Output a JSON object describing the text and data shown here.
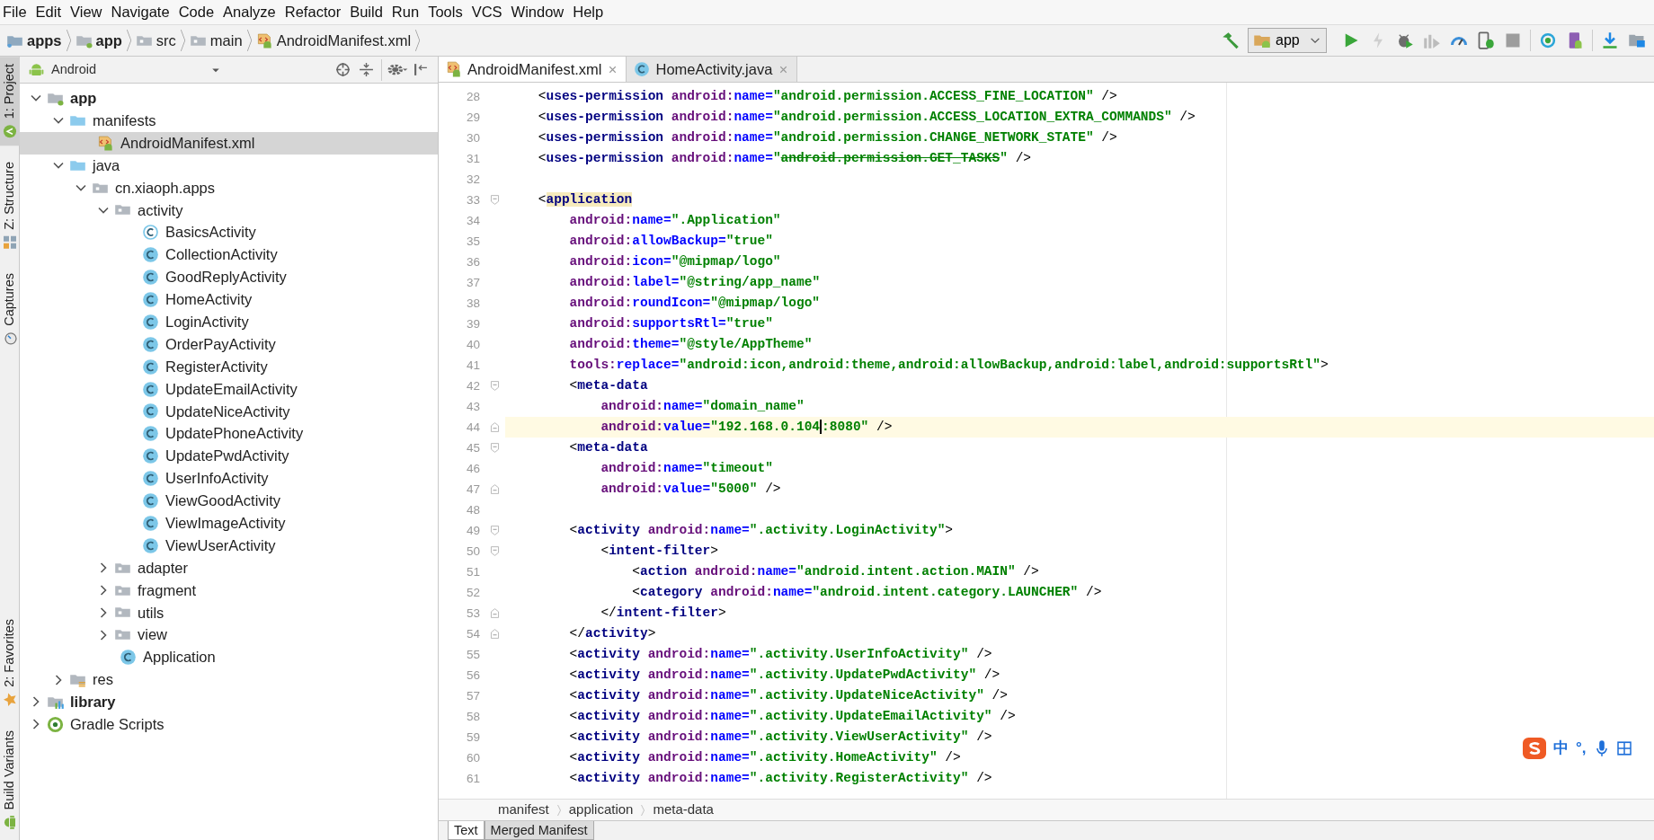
{
  "menu": [
    "File",
    "Edit",
    "View",
    "Navigate",
    "Code",
    "Analyze",
    "Refactor",
    "Build",
    "Run",
    "Tools",
    "VCS",
    "Window",
    "Help"
  ],
  "breadcrumb": [
    {
      "label": "apps",
      "kind": "project"
    },
    {
      "label": "app",
      "kind": "module"
    },
    {
      "label": "src",
      "kind": "folder"
    },
    {
      "label": "main",
      "kind": "folder"
    },
    {
      "label": "AndroidManifest.xml",
      "kind": "manifest"
    }
  ],
  "run_config": {
    "label": "app"
  },
  "toolbar": [
    {
      "kind": "build",
      "disabled": false
    },
    {
      "kind": "run",
      "disabled": false
    },
    {
      "kind": "apply",
      "disabled": true
    },
    {
      "kind": "debug",
      "disabled": false
    },
    {
      "kind": "profile",
      "disabled": true
    },
    {
      "kind": "attach",
      "disabled": false
    },
    {
      "kind": "device_debug",
      "disabled": false
    },
    {
      "kind": "stop",
      "disabled": true
    },
    {
      "kind": "sync",
      "disabled": false
    },
    {
      "kind": "avd",
      "disabled": false
    },
    {
      "kind": "sdk",
      "disabled": false
    },
    {
      "kind": "structure",
      "disabled": false
    }
  ],
  "side_tabs_top": [
    {
      "label": "1: Project",
      "kind": "project",
      "selected": true
    },
    {
      "label": "Z: Structure",
      "kind": "structure",
      "selected": false
    },
    {
      "label": "Captures",
      "kind": "captures",
      "selected": false
    }
  ],
  "side_tabs_bottom": [
    {
      "label": "2: Favorites",
      "kind": "favorites",
      "selected": false
    },
    {
      "label": "Build Variants",
      "kind": "variants",
      "selected": false
    }
  ],
  "project_panel": {
    "view": "Android",
    "tree": [
      {
        "label": "app",
        "kind": "module",
        "expanded": true,
        "selected": false,
        "children": [
          {
            "label": "manifests",
            "kind": "folder",
            "expanded": true,
            "selected": false,
            "children": [
              {
                "label": "AndroidManifest.xml",
                "kind": "manifest",
                "selected": true
              }
            ]
          },
          {
            "label": "java",
            "kind": "folder",
            "expanded": true,
            "selected": false,
            "children": [
              {
                "label": "cn.xiaoph.apps",
                "kind": "package",
                "expanded": true,
                "selected": false,
                "children": [
                  {
                    "label": "activity",
                    "kind": "package",
                    "expanded": true,
                    "selected": false,
                    "children": [
                      {
                        "label": "BasicsActivity",
                        "kind": "abstract_class",
                        "selected": false
                      },
                      {
                        "label": "CollectionActivity",
                        "kind": "class",
                        "selected": false
                      },
                      {
                        "label": "GoodReplyActivity",
                        "kind": "class",
                        "selected": false
                      },
                      {
                        "label": "HomeActivity",
                        "kind": "class",
                        "selected": false
                      },
                      {
                        "label": "LoginActivity",
                        "kind": "class",
                        "selected": false
                      },
                      {
                        "label": "OrderPayActivity",
                        "kind": "class",
                        "selected": false
                      },
                      {
                        "label": "RegisterActivity",
                        "kind": "class",
                        "selected": false
                      },
                      {
                        "label": "UpdateEmailActivity",
                        "kind": "class",
                        "selected": false
                      },
                      {
                        "label": "UpdateNiceActivity",
                        "kind": "class",
                        "selected": false
                      },
                      {
                        "label": "UpdatePhoneActivity",
                        "kind": "class",
                        "selected": false
                      },
                      {
                        "label": "UpdatePwdActivity",
                        "kind": "class",
                        "selected": false
                      },
                      {
                        "label": "UserInfoActivity",
                        "kind": "class",
                        "selected": false
                      },
                      {
                        "label": "ViewGoodActivity",
                        "kind": "class",
                        "selected": false
                      },
                      {
                        "label": "ViewImageActivity",
                        "kind": "class",
                        "selected": false
                      },
                      {
                        "label": "ViewUserActivity",
                        "kind": "class",
                        "selected": false
                      }
                    ]
                  },
                  {
                    "label": "adapter",
                    "kind": "package",
                    "expanded": false,
                    "selected": false
                  },
                  {
                    "label": "fragment",
                    "kind": "package",
                    "expanded": false,
                    "selected": false
                  },
                  {
                    "label": "utils",
                    "kind": "package",
                    "expanded": false,
                    "selected": false
                  },
                  {
                    "label": "view",
                    "kind": "package",
                    "expanded": false,
                    "selected": false
                  },
                  {
                    "label": "Application",
                    "kind": "class",
                    "selected": false
                  }
                ]
              }
            ]
          },
          {
            "label": "res",
            "kind": "res",
            "expanded": false,
            "selected": false
          }
        ]
      },
      {
        "label": "library",
        "kind": "library",
        "expanded": false,
        "selected": false
      },
      {
        "label": "Gradle Scripts",
        "kind": "gradle",
        "expanded": false,
        "selected": false
      }
    ]
  },
  "editor_tabs": [
    {
      "label": "AndroidManifest.xml",
      "kind": "manifest",
      "selected": true
    },
    {
      "label": "HomeActivity.java",
      "kind": "class",
      "selected": false
    }
  ],
  "code": [
    {
      "number": "28",
      "current": false,
      "tokens": [
        {
          "kind": "p",
          "text": "    <"
        },
        {
          "kind": "tag",
          "text": "uses-permission"
        },
        {
          "kind": "ns",
          "text": " android:"
        },
        {
          "kind": "attr",
          "text": "name="
        },
        {
          "kind": "val",
          "text": "\"android.permission.ACCESS_FINE_LOCATION\""
        },
        {
          "kind": "p",
          "text": " />"
        }
      ]
    },
    {
      "number": "29",
      "current": false,
      "tokens": [
        {
          "kind": "p",
          "text": "    <"
        },
        {
          "kind": "tag",
          "text": "uses-permission"
        },
        {
          "kind": "ns",
          "text": " android:"
        },
        {
          "kind": "attr",
          "text": "name="
        },
        {
          "kind": "val",
          "text": "\"android.permission.ACCESS_LOCATION_EXTRA_COMMANDS\""
        },
        {
          "kind": "p",
          "text": " />"
        }
      ]
    },
    {
      "number": "30",
      "current": false,
      "tokens": [
        {
          "kind": "p",
          "text": "    <"
        },
        {
          "kind": "tag",
          "text": "uses-permission"
        },
        {
          "kind": "ns",
          "text": " android:"
        },
        {
          "kind": "attr",
          "text": "name="
        },
        {
          "kind": "val",
          "text": "\"android.permission.CHANGE_NETWORK_STATE\""
        },
        {
          "kind": "p",
          "text": " />"
        }
      ]
    },
    {
      "number": "31",
      "current": false,
      "tokens": [
        {
          "kind": "p",
          "text": "    <"
        },
        {
          "kind": "tag",
          "text": "uses-permission"
        },
        {
          "kind": "ns",
          "text": " android:"
        },
        {
          "kind": "attr",
          "text": "name="
        },
        {
          "kind": "val",
          "text": "\""
        },
        {
          "kind": "deprecated",
          "text": "android.permission.GET_TASKS"
        },
        {
          "kind": "val",
          "text": "\""
        },
        {
          "kind": "p",
          "text": " />"
        }
      ]
    },
    {
      "number": "32",
      "current": false
    },
    {
      "number": "33",
      "current": false,
      "kind": "fold_start",
      "tokens": [
        {
          "kind": "p",
          "text": "    <"
        },
        {
          "kind": "tag_match",
          "text": "application"
        }
      ]
    },
    {
      "number": "34",
      "current": false,
      "tokens": [
        {
          "kind": "ns",
          "text": "        android:"
        },
        {
          "kind": "attr",
          "text": "name="
        },
        {
          "kind": "val",
          "text": "\".Application\""
        }
      ]
    },
    {
      "number": "35",
      "current": false,
      "tokens": [
        {
          "kind": "ns",
          "text": "        android:"
        },
        {
          "kind": "attr",
          "text": "allowBackup="
        },
        {
          "kind": "val",
          "text": "\"true\""
        }
      ]
    },
    {
      "number": "36",
      "current": false,
      "tokens": [
        {
          "kind": "ns",
          "text": "        android:"
        },
        {
          "kind": "attr",
          "text": "icon="
        },
        {
          "kind": "val",
          "text": "\"@mipmap/logo\""
        }
      ]
    },
    {
      "number": "37",
      "current": false,
      "tokens": [
        {
          "kind": "ns",
          "text": "        android:"
        },
        {
          "kind": "attr",
          "text": "label="
        },
        {
          "kind": "val",
          "text": "\"@string/app_name\""
        }
      ]
    },
    {
      "number": "38",
      "current": false,
      "tokens": [
        {
          "kind": "ns",
          "text": "        android:"
        },
        {
          "kind": "attr",
          "text": "roundIcon="
        },
        {
          "kind": "val",
          "text": "\"@mipmap/logo\""
        }
      ]
    },
    {
      "number": "39",
      "current": false,
      "tokens": [
        {
          "kind": "ns",
          "text": "        android:"
        },
        {
          "kind": "attr",
          "text": "supportsRtl="
        },
        {
          "kind": "val",
          "text": "\"true\""
        }
      ]
    },
    {
      "number": "40",
      "current": false,
      "tokens": [
        {
          "kind": "ns",
          "text": "        android:"
        },
        {
          "kind": "attr",
          "text": "theme="
        },
        {
          "kind": "val",
          "text": "\"@style/AppTheme\""
        }
      ]
    },
    {
      "number": "41",
      "current": false,
      "tokens": [
        {
          "kind": "ns",
          "text": "        tools:"
        },
        {
          "kind": "attr",
          "text": "replace="
        },
        {
          "kind": "val",
          "text": "\"android:icon,android:theme,android:allowBackup,android:label,android:supportsRtl\""
        },
        {
          "kind": "p",
          "text": ">"
        }
      ]
    },
    {
      "number": "42",
      "current": false,
      "kind": "fold_start",
      "tokens": [
        {
          "kind": "p",
          "text": "        <"
        },
        {
          "kind": "tag",
          "text": "meta-data"
        }
      ]
    },
    {
      "number": "43",
      "current": false,
      "tokens": [
        {
          "kind": "ns",
          "text": "            android:"
        },
        {
          "kind": "attr",
          "text": "name="
        },
        {
          "kind": "val",
          "text": "\"domain_name\""
        }
      ]
    },
    {
      "number": "44",
      "current": true,
      "kind": "fold_end",
      "tokens": [
        {
          "kind": "ns",
          "text": "            android:"
        },
        {
          "kind": "attr",
          "text": "value="
        },
        {
          "kind": "val_caret",
          "text": "\"192.168.0.104"
        },
        {
          "kind": "val",
          "text": ":8080\""
        },
        {
          "kind": "p",
          "text": " />"
        }
      ]
    },
    {
      "number": "45",
      "current": false,
      "kind": "fold_start",
      "tokens": [
        {
          "kind": "p",
          "text": "        <"
        },
        {
          "kind": "tag",
          "text": "meta-data"
        }
      ]
    },
    {
      "number": "46",
      "current": false,
      "tokens": [
        {
          "kind": "ns",
          "text": "            android:"
        },
        {
          "kind": "attr",
          "text": "name="
        },
        {
          "kind": "val",
          "text": "\"timeout\""
        }
      ]
    },
    {
      "number": "47",
      "current": false,
      "kind": "fold_end",
      "tokens": [
        {
          "kind": "ns",
          "text": "            android:"
        },
        {
          "kind": "attr",
          "text": "value="
        },
        {
          "kind": "val",
          "text": "\"5000\""
        },
        {
          "kind": "p",
          "text": " />"
        }
      ]
    },
    {
      "number": "48",
      "current": false
    },
    {
      "number": "49",
      "current": false,
      "kind": "fold_start",
      "tokens": [
        {
          "kind": "p",
          "text": "        <"
        },
        {
          "kind": "tag",
          "text": "activity"
        },
        {
          "kind": "ns",
          "text": " android:"
        },
        {
          "kind": "attr",
          "text": "name="
        },
        {
          "kind": "val",
          "text": "\".activity.LoginActivity\""
        },
        {
          "kind": "p",
          "text": ">"
        }
      ]
    },
    {
      "number": "50",
      "current": false,
      "kind": "fold_start",
      "tokens": [
        {
          "kind": "p",
          "text": "            <"
        },
        {
          "kind": "tag",
          "text": "intent-filter"
        },
        {
          "kind": "p",
          "text": ">"
        }
      ]
    },
    {
      "number": "51",
      "current": false,
      "tokens": [
        {
          "kind": "p",
          "text": "                <"
        },
        {
          "kind": "tag",
          "text": "action"
        },
        {
          "kind": "ns",
          "text": " android:"
        },
        {
          "kind": "attr",
          "text": "name="
        },
        {
          "kind": "val",
          "text": "\"android.intent.action.MAIN\""
        },
        {
          "kind": "p",
          "text": " />"
        }
      ]
    },
    {
      "number": "52",
      "current": false,
      "tokens": [
        {
          "kind": "p",
          "text": "                <"
        },
        {
          "kind": "tag",
          "text": "category"
        },
        {
          "kind": "ns",
          "text": " android:"
        },
        {
          "kind": "attr",
          "text": "name="
        },
        {
          "kind": "val",
          "text": "\"android.intent.category.LAUNCHER\""
        },
        {
          "kind": "p",
          "text": " />"
        }
      ]
    },
    {
      "number": "53",
      "current": false,
      "kind": "fold_end",
      "tokens": [
        {
          "kind": "p",
          "text": "            </"
        },
        {
          "kind": "tag",
          "text": "intent-filter"
        },
        {
          "kind": "p",
          "text": ">"
        }
      ]
    },
    {
      "number": "54",
      "current": false,
      "kind": "fold_end",
      "tokens": [
        {
          "kind": "p",
          "text": "        </"
        },
        {
          "kind": "tag",
          "text": "activity"
        },
        {
          "kind": "p",
          "text": ">"
        }
      ]
    },
    {
      "number": "55",
      "current": false,
      "tokens": [
        {
          "kind": "p",
          "text": "        <"
        },
        {
          "kind": "tag",
          "text": "activity"
        },
        {
          "kind": "ns",
          "text": " android:"
        },
        {
          "kind": "attr",
          "text": "name="
        },
        {
          "kind": "val",
          "text": "\".activity.UserInfoActivity\""
        },
        {
          "kind": "p",
          "text": " />"
        }
      ]
    },
    {
      "number": "56",
      "current": false,
      "tokens": [
        {
          "kind": "p",
          "text": "        <"
        },
        {
          "kind": "tag",
          "text": "activity"
        },
        {
          "kind": "ns",
          "text": " android:"
        },
        {
          "kind": "attr",
          "text": "name="
        },
        {
          "kind": "val",
          "text": "\".activity.UpdatePwdActivity\""
        },
        {
          "kind": "p",
          "text": " />"
        }
      ]
    },
    {
      "number": "57",
      "current": false,
      "tokens": [
        {
          "kind": "p",
          "text": "        <"
        },
        {
          "kind": "tag",
          "text": "activity"
        },
        {
          "kind": "ns",
          "text": " android:"
        },
        {
          "kind": "attr",
          "text": "name="
        },
        {
          "kind": "val",
          "text": "\".activity.UpdateNiceActivity\""
        },
        {
          "kind": "p",
          "text": " />"
        }
      ]
    },
    {
      "number": "58",
      "current": false,
      "tokens": [
        {
          "kind": "p",
          "text": "        <"
        },
        {
          "kind": "tag",
          "text": "activity"
        },
        {
          "kind": "ns",
          "text": " android:"
        },
        {
          "kind": "attr",
          "text": "name="
        },
        {
          "kind": "val",
          "text": "\".activity.UpdateEmailActivity\""
        },
        {
          "kind": "p",
          "text": " />"
        }
      ]
    },
    {
      "number": "59",
      "current": false,
      "tokens": [
        {
          "kind": "p",
          "text": "        <"
        },
        {
          "kind": "tag",
          "text": "activity"
        },
        {
          "kind": "ns",
          "text": " android:"
        },
        {
          "kind": "attr",
          "text": "name="
        },
        {
          "kind": "val",
          "text": "\".activity.ViewUserActivity\""
        },
        {
          "kind": "p",
          "text": " />"
        }
      ]
    },
    {
      "number": "60",
      "current": false,
      "tokens": [
        {
          "kind": "p",
          "text": "        <"
        },
        {
          "kind": "tag",
          "text": "activity"
        },
        {
          "kind": "ns",
          "text": " android:"
        },
        {
          "kind": "attr",
          "text": "name="
        },
        {
          "kind": "val",
          "text": "\".activity.HomeActivity\""
        },
        {
          "kind": "p",
          "text": " />"
        }
      ]
    },
    {
      "number": "61",
      "current": false,
      "tokens": [
        {
          "kind": "p",
          "text": "        <"
        },
        {
          "kind": "tag",
          "text": "activity"
        },
        {
          "kind": "ns",
          "text": " android:"
        },
        {
          "kind": "attr",
          "text": "name="
        },
        {
          "kind": "val",
          "text": "\".activity.RegisterActivity\""
        },
        {
          "kind": "p",
          "text": " />"
        }
      ]
    }
  ],
  "editor_breadcrumb": [
    "manifest",
    "application",
    "meta-data"
  ],
  "bottom_tabs": [
    {
      "label": "Text",
      "selected": true
    },
    {
      "label": "Merged Manifest",
      "selected": false
    }
  ],
  "ime_bar": {
    "mode": "中",
    "punctuation": "°,"
  }
}
